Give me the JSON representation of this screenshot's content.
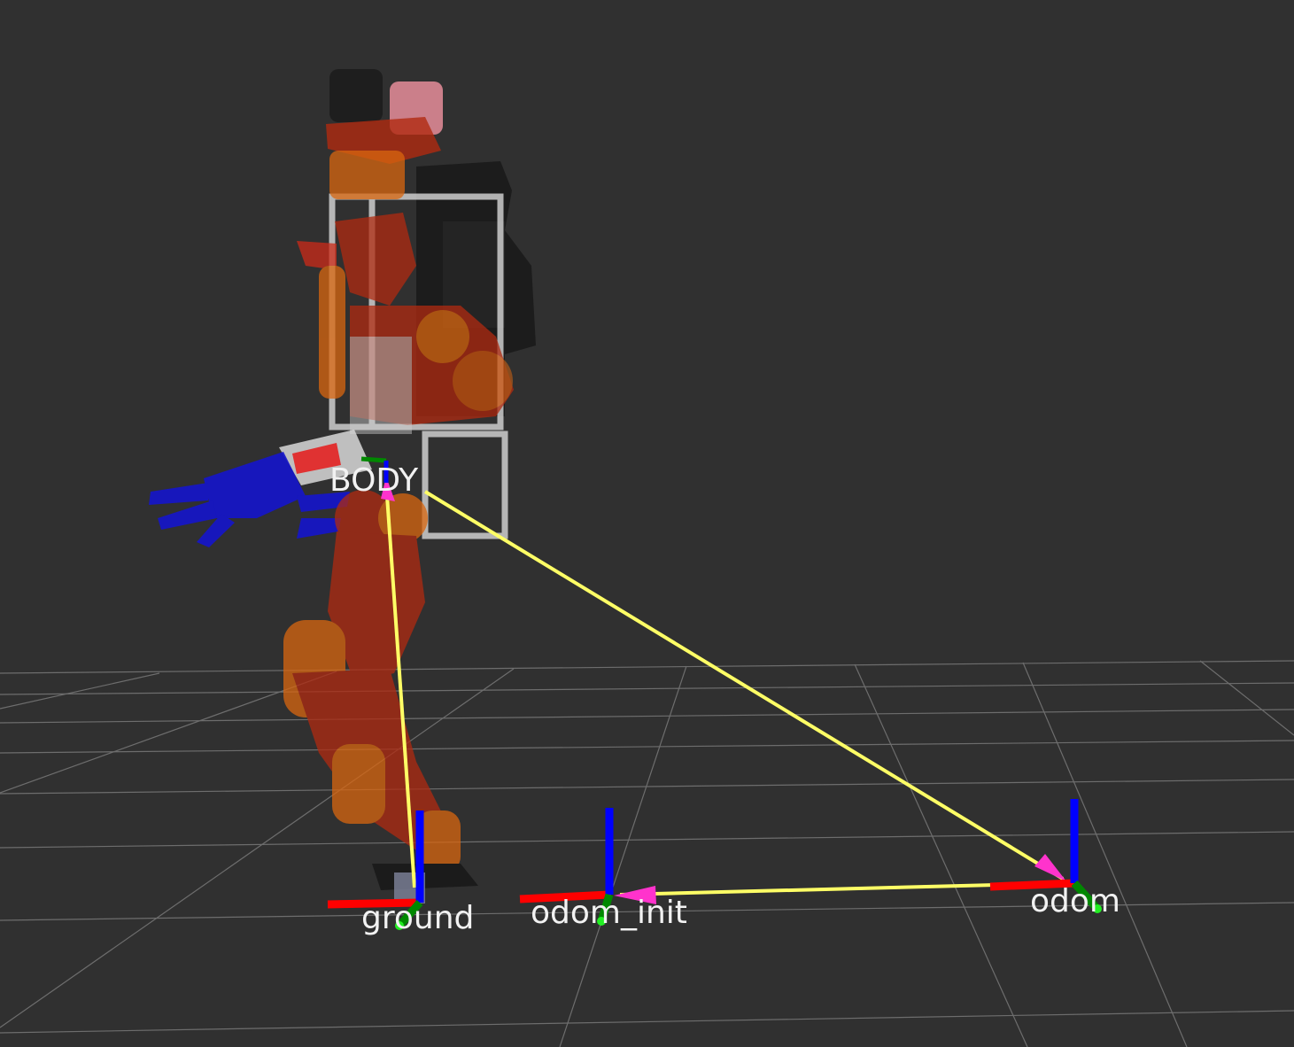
{
  "viewport": {
    "background": "#303030",
    "grid_color": "#a0a0a0"
  },
  "tf_frames": {
    "body": "BODY",
    "ground": "ground",
    "odom_init": "odom_init",
    "odom": "odom"
  },
  "axis_colors": {
    "x": "#ff0000",
    "y": "#008800",
    "z": "#0000ff"
  },
  "link_colors": {
    "arrow_line": "#ffff66",
    "arrow_head": "#ff33cc"
  },
  "robot_colors": {
    "leg": "#b02a10",
    "joint": "#d9660f",
    "frame": "#d8d8d8",
    "hand": "#1515cc",
    "head": "#ff9aa8",
    "shadow": "#141414"
  }
}
